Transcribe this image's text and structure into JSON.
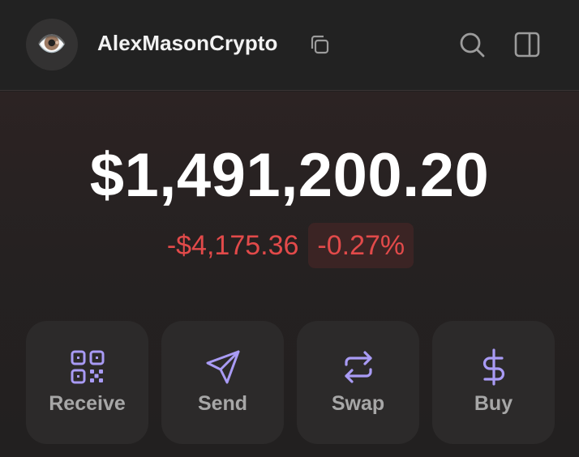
{
  "header": {
    "avatar_emoji": "👁️",
    "account_name": "AlexMasonCrypto",
    "icons": {
      "copy": "copy-icon",
      "search": "search-icon",
      "sidebar": "sidebar-panel-icon"
    }
  },
  "portfolio": {
    "balance": "$1,491,200.20",
    "change_amount": "-$4,175.36",
    "change_percent": "-0.27%"
  },
  "actions": [
    {
      "label": "Receive",
      "icon": "qr-code-icon"
    },
    {
      "label": "Send",
      "icon": "send-icon"
    },
    {
      "label": "Swap",
      "icon": "swap-icon"
    },
    {
      "label": "Buy",
      "icon": "dollar-icon"
    }
  ],
  "colors": {
    "accent": "#a99bf5",
    "negative": "#e24a4a",
    "negative_bg": "#3b2424",
    "background": "#222222",
    "button_bg": "#2c2a2a",
    "label_gray": "#a7a7a7"
  }
}
